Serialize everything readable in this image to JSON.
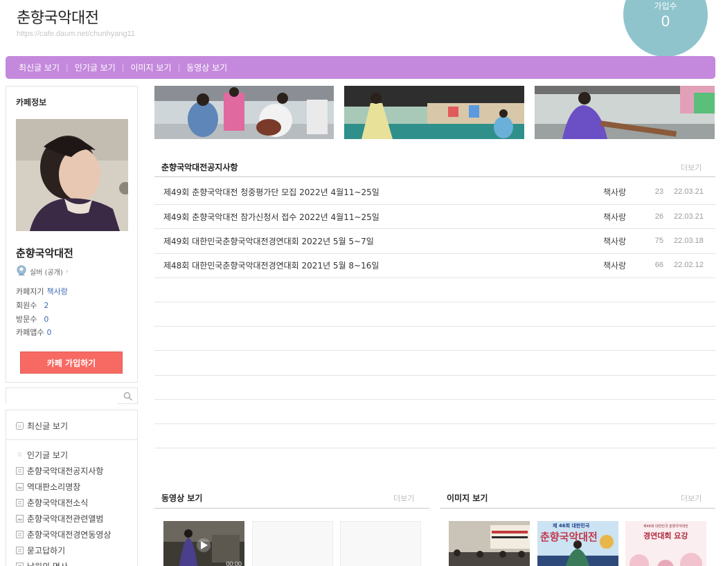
{
  "header": {
    "title": "춘향국악대전",
    "url": "https://cafe.daum.net/chunhyang11",
    "visitor_label": "가입수",
    "visitor_count": "0"
  },
  "menubar": {
    "items": [
      "최신글 보기",
      "인기글 보기",
      "이미지 보기",
      "동영상 보기"
    ],
    "separator": "|"
  },
  "sidebar": {
    "cafe_info_label": "카페정보",
    "cafe_name": "춘향국악대전",
    "grade": "실버 (공개)",
    "stats": [
      {
        "label": "카페지기",
        "value": "책사랑"
      },
      {
        "label": "회원수",
        "value": "2"
      },
      {
        "label": "방문수",
        "value": "0"
      },
      {
        "label": "카페앱수",
        "value": "0"
      }
    ],
    "join_button": "카페 가입하기",
    "search_placeholder": "",
    "menu_items": [
      {
        "icon": "new-icon",
        "label": "최신글 보기"
      },
      {
        "icon": "star-icon",
        "label": "인기글 보기"
      },
      {
        "icon": "board-icon",
        "label": "춘향국악대전공지사항"
      },
      {
        "icon": "album-icon",
        "label": "역대판소리명창"
      },
      {
        "icon": "board-icon",
        "label": "춘향국악대전소식"
      },
      {
        "icon": "album-icon",
        "label": "춘향국악대전관련앨범"
      },
      {
        "icon": "board-icon",
        "label": "춘향국악대전경연동영상"
      },
      {
        "icon": "board-icon",
        "label": "묻고답하기"
      },
      {
        "icon": "board-icon",
        "label": "남원의 명사"
      }
    ]
  },
  "notice": {
    "title": "춘향국악대전공지사항",
    "more": "더보기",
    "rows": [
      {
        "title": "제49회 춘향국악대전 청중평가단 모집 2022년 4월11~25일",
        "author": "책사랑",
        "views": "23",
        "date": "22.03.21"
      },
      {
        "title": "제49회 춘향국악대전 참가신청서 접수 2022년 4월11~25일",
        "author": "책사랑",
        "views": "26",
        "date": "22.03.21"
      },
      {
        "title": "제49회 대한민국춘향국악대전경연대회 2022년 5월 5~7일",
        "author": "책사랑",
        "views": "75",
        "date": "22.03.18"
      },
      {
        "title": "제48회 대한민국춘향국악대전경연대회 2021년 5월 8~16일",
        "author": "책사랑",
        "views": "66",
        "date": "22.02.12"
      }
    ]
  },
  "video_section": {
    "title": "동영상 보기",
    "more": "더보기",
    "duration": "00:00"
  },
  "image_section": {
    "title": "이미지 보기",
    "more": "더보기",
    "poster1_line1": "제 46회 대한민국",
    "poster1_line2": "춘향국악대전",
    "poster2_line1": "제48회 대한민국 춘향국악대전",
    "poster2_line2": "경연대회 요강"
  }
}
